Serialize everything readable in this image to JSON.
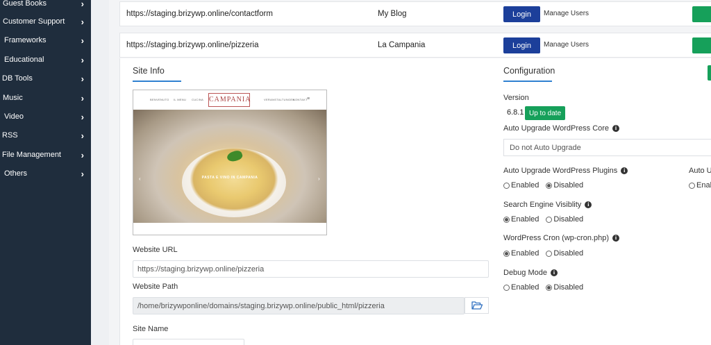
{
  "sidebar": {
    "items": [
      {
        "label": "Guest Books"
      },
      {
        "label": "Customer Support"
      },
      {
        "label": "Frameworks"
      },
      {
        "label": "Educational"
      },
      {
        "label": "DB Tools"
      },
      {
        "label": "Music"
      },
      {
        "label": "Video"
      },
      {
        "label": "RSS"
      },
      {
        "label": "File Management"
      },
      {
        "label": "Others"
      }
    ]
  },
  "installs": [
    {
      "url": "https://staging.brizywp.online/contactform",
      "site": "My Blog",
      "login_label": "Login",
      "manage_label": "Manage Users"
    },
    {
      "url": "https://staging.brizywp.online/pizzeria",
      "site": "La Campania",
      "login_label": "Login",
      "manage_label": "Manage Users"
    }
  ],
  "site_info": {
    "title": "Site Info",
    "preview": {
      "logo_text": "CAMPANIA",
      "nav": [
        "BENVENUTO",
        "IL MENU",
        "CUCINA",
        "VERANSTALTUNGEN",
        "KONTAKT"
      ],
      "hero_text": "PASTA E VINO IN CAMPANIA"
    },
    "website_url_label": "Website URL",
    "website_url_value": "https://staging.brizywp.online/pizzeria",
    "website_path_label": "Website Path",
    "website_path_value": "/home/brizywponline/domains/staging.brizywp.online/public_html/pizzeria",
    "site_name_label": "Site Name"
  },
  "configuration": {
    "title": "Configuration",
    "version_label": "Version",
    "version_value": "6.8.1",
    "version_status": "Up to date",
    "auto_upgrade_core_label": "Auto Upgrade WordPress Core",
    "auto_upgrade_core_value": "Do not Auto Upgrade",
    "auto_upgrade_plugins_label": "Auto Upgrade WordPress Plugins",
    "auto_upgrade_themes_label_partial": "Auto U",
    "auto_upgrade_themes_enabled_partial": "Enab",
    "search_engine_label": "Search Engine Visiblity",
    "wp_cron_label": "WordPress Cron (wp-cron.php)",
    "debug_label": "Debug Mode",
    "enabled_label": "Enabled",
    "disabled_label": "Disabled"
  },
  "colors": {
    "sidebar_bg": "#1f2d3d",
    "login_btn": "#1c3f9a",
    "success": "#16a05a",
    "accent_underline": "#2f80d1"
  }
}
